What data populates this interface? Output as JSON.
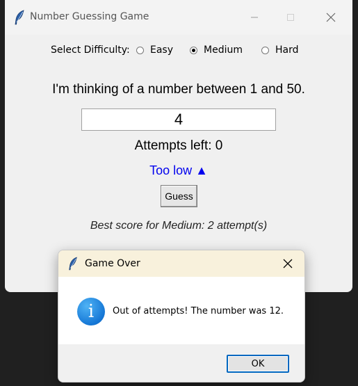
{
  "main_window": {
    "title": "Number Guessing Game",
    "difficulty": {
      "label": "Select Difficulty:",
      "options": [
        {
          "label": "Easy",
          "selected": false
        },
        {
          "label": "Medium",
          "selected": true
        },
        {
          "label": "Hard",
          "selected": false
        }
      ]
    },
    "prompt": "I'm thinking of a number between 1 and 50.",
    "guess_value": "4",
    "attempts_text": "Attempts left: 0",
    "feedback_text": "Too low ▲",
    "guess_button": "Guess",
    "best_score_text": "Best score for Medium: 2 attempt(s)"
  },
  "dialog": {
    "title": "Game Over",
    "message": "Out of attempts! The number was 12.",
    "ok_button": "OK",
    "icon": "info-icon"
  },
  "colors": {
    "feedback": "#0000ee",
    "dialog_titlebar": "#f8f1dc",
    "info_icon": "#1577d6",
    "ok_border": "#0067c0"
  },
  "icons": {
    "app": "feather-icon",
    "minimize": "minimize-icon",
    "maximize": "maximize-icon",
    "close": "close-icon"
  }
}
